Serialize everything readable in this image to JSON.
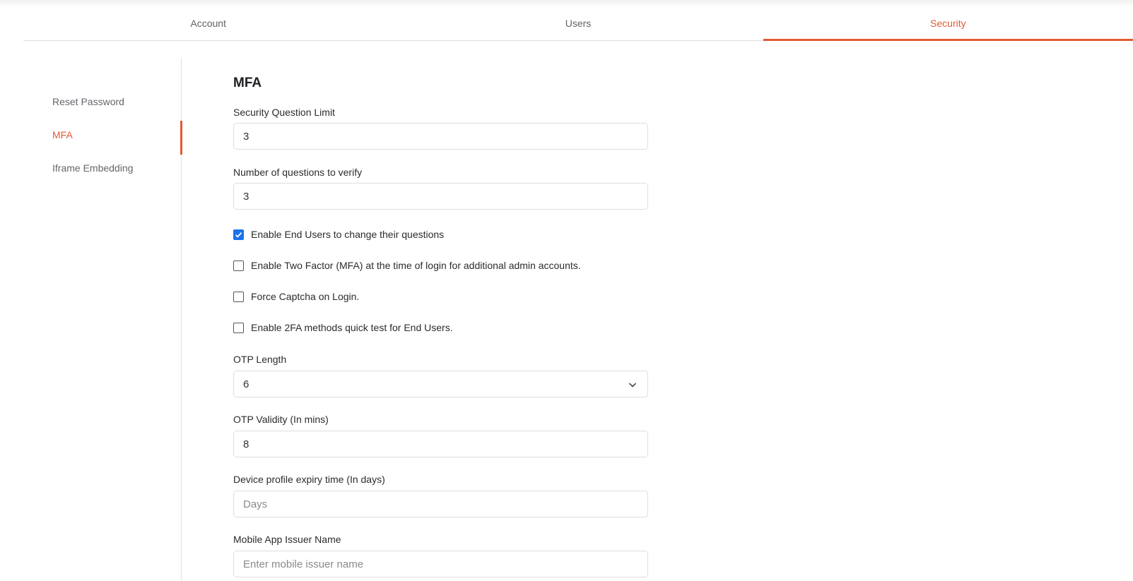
{
  "tabs": [
    {
      "label": "Account",
      "active": false
    },
    {
      "label": "Users",
      "active": false
    },
    {
      "label": "Security",
      "active": true
    }
  ],
  "sidebar": {
    "items": [
      {
        "label": "Reset Password",
        "active": false
      },
      {
        "label": "MFA",
        "active": true
      },
      {
        "label": "Iframe Embedding",
        "active": false
      }
    ]
  },
  "main": {
    "title": "MFA",
    "security_question_limit": {
      "label": "Security Question Limit",
      "value": "3"
    },
    "questions_to_verify": {
      "label": "Number of questions to verify",
      "value": "3"
    },
    "checkboxes": [
      {
        "label": "Enable End Users to change their questions",
        "checked": true
      },
      {
        "label": "Enable Two Factor (MFA) at the time of login for additional admin accounts.",
        "checked": false
      },
      {
        "label": "Force Captcha on Login.",
        "checked": false
      },
      {
        "label": "Enable 2FA methods quick test for End Users.",
        "checked": false
      }
    ],
    "otp_length": {
      "label": "OTP Length",
      "value": "6",
      "icon": "chevron-down-icon"
    },
    "otp_validity": {
      "label": "OTP Validity (In mins)",
      "value": "8"
    },
    "device_profile_expiry": {
      "label": "Device profile expiry time (In days)",
      "value": "",
      "placeholder": "Days"
    },
    "mobile_issuer": {
      "label": "Mobile App Issuer Name",
      "value": "",
      "placeholder": "Enter mobile issuer name"
    }
  },
  "colors": {
    "accent": "#e25a35",
    "checkbox_checked": "#1a73e8"
  }
}
